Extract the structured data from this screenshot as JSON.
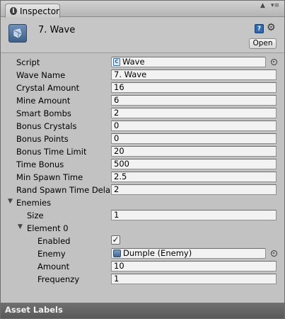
{
  "tab": {
    "label": "Inspector",
    "icon": "info-icon"
  },
  "window_controls": {
    "lock": "lock-icon",
    "menu": "menu-icon"
  },
  "header": {
    "title": "7. Wave",
    "open_label": "Open",
    "icons": [
      "gameobject-icon",
      "help-book-icon",
      "gear-icon"
    ]
  },
  "fields": [
    {
      "label": "Script",
      "value": "Wave"
    },
    {
      "label": "Wave Name",
      "value": "7. Wave"
    },
    {
      "label": "Crystal Amount",
      "value": "16"
    },
    {
      "label": "Mine Amount",
      "value": "6"
    },
    {
      "label": "Smart Bombs",
      "value": "2"
    },
    {
      "label": "Bonus Crystals",
      "value": "0"
    },
    {
      "label": "Bonus Points",
      "value": "0"
    },
    {
      "label": "Bonus Time Limit",
      "value": "20"
    },
    {
      "label": "Time Bonus",
      "value": "500"
    },
    {
      "label": "Min Spawn Time",
      "value": "2.5"
    },
    {
      "label": "Rand Spawn Time Dela",
      "value": "2"
    }
  ],
  "enemies": {
    "label": "Enemies",
    "size_label": "Size",
    "size_value": "1",
    "element": {
      "label": "Element 0",
      "enabled_label": "Enabled",
      "enabled": true,
      "enemy_label": "Enemy",
      "enemy_value": "Dumple (Enemy)",
      "amount_label": "Amount",
      "amount_value": "10",
      "frequenzy_label": "Frequenzy",
      "frequenzy_value": "1"
    }
  },
  "footer": {
    "label": "Asset Labels"
  }
}
